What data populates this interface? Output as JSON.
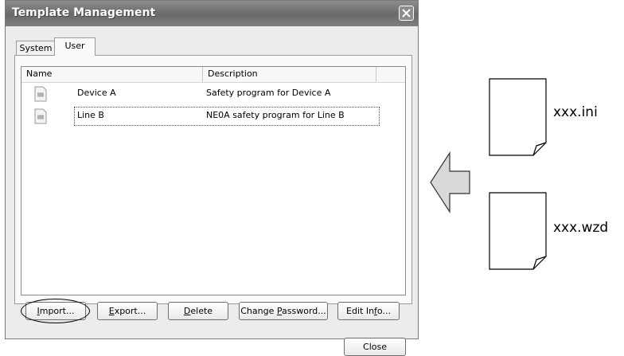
{
  "window": {
    "title": "Template Management"
  },
  "tabs": [
    {
      "label": "System"
    },
    {
      "label": "User"
    }
  ],
  "list": {
    "columns": [
      "Name",
      "Description"
    ],
    "rows": [
      {
        "name": "Device A",
        "description": "Safety program for Device A"
      },
      {
        "name": "Line B",
        "description": "NE0A safety program for Line B"
      }
    ]
  },
  "buttons": {
    "import": {
      "pre": "",
      "key": "I",
      "post": "mport..."
    },
    "export": {
      "pre": "",
      "key": "E",
      "post": "xport..."
    },
    "delete": {
      "pre": "",
      "key": "D",
      "post": "elete"
    },
    "change_password": {
      "pre": "Change ",
      "key": "P",
      "post": "assword..."
    },
    "edit_info": {
      "pre": "Edit In",
      "key": "f",
      "post": "o..."
    },
    "close": "Close"
  },
  "files": [
    {
      "label": "xxx.ini"
    },
    {
      "label": "xxx.wzd"
    }
  ],
  "colors": {
    "titlebar": "#7a7a7a",
    "dialog_bg": "#ececec",
    "arrow_fill": "#d9d9d9"
  }
}
